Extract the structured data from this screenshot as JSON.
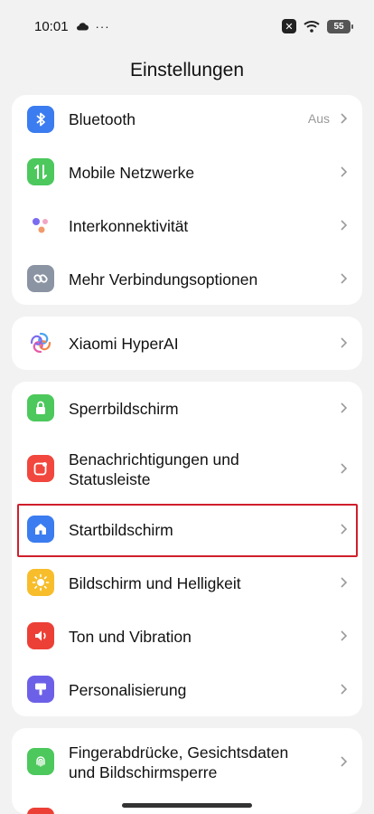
{
  "status": {
    "time": "10:01",
    "battery": "55"
  },
  "header": {
    "title": "Einstellungen"
  },
  "cards": {
    "connectivity": [
      {
        "label": "Bluetooth",
        "value": "Aus",
        "icon": "bluetooth-icon",
        "color": "#3b7cf0"
      },
      {
        "label": "Mobile Netzwerke",
        "icon": "mobile-data-icon",
        "color": "#4cc85c"
      },
      {
        "label": "Interkonnektivität",
        "icon": "interconnect-icon",
        "color": "#ffffff"
      },
      {
        "label": "Mehr Verbindungsoptionen",
        "icon": "link-icon",
        "color": "#8b94a3"
      }
    ],
    "ai": [
      {
        "label": "Xiaomi HyperAI",
        "icon": "hyperai-icon",
        "color": "#ffffff"
      }
    ],
    "display": [
      {
        "label": "Sperrbildschirm",
        "icon": "lock-icon",
        "color": "#4cc85c"
      },
      {
        "label": "Benachrichtigungen und Statusleiste",
        "icon": "notification-icon",
        "color": "#f1473e"
      },
      {
        "label": "Startbildschirm",
        "icon": "home-icon",
        "color": "#3b7cf0"
      },
      {
        "label": "Bildschirm und Helligkeit",
        "icon": "brightness-icon",
        "color": "#f7bd2b"
      },
      {
        "label": "Ton und Vibration",
        "icon": "sound-icon",
        "color": "#ec4036"
      },
      {
        "label": "Personalisierung",
        "icon": "personalization-icon",
        "color": "#6d60e8"
      }
    ],
    "security": [
      {
        "label": "Fingerabdrücke, Gesichtsdaten und Bildschirmsperre",
        "icon": "fingerprint-icon",
        "color": "#4cc85c"
      }
    ]
  }
}
